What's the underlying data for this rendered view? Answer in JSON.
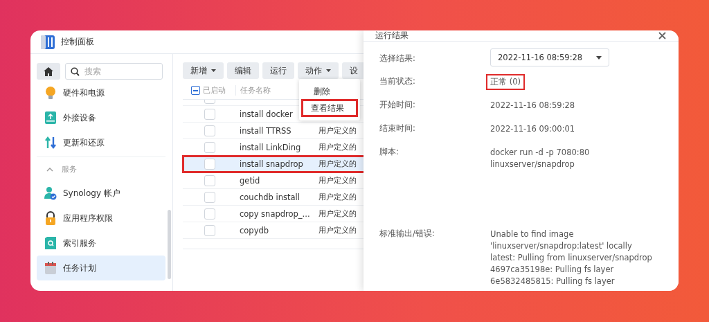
{
  "window": {
    "title": "控制面板"
  },
  "search": {
    "placeholder": "搜索"
  },
  "sidebar": {
    "items": [
      {
        "kind": "item",
        "label": "硬件和电源",
        "selected": false
      },
      {
        "kind": "item",
        "label": "外接设备",
        "selected": false
      },
      {
        "kind": "item",
        "label": "更新和还原",
        "selected": false
      },
      {
        "kind": "section",
        "label": "服务",
        "expanded": true
      },
      {
        "kind": "item",
        "label": "Synology 帐户",
        "selected": false
      },
      {
        "kind": "item",
        "label": "应用程序权限",
        "selected": false
      },
      {
        "kind": "item",
        "label": "索引服务",
        "selected": false
      },
      {
        "kind": "item",
        "label": "任务计划",
        "selected": true
      }
    ]
  },
  "toolbar": [
    {
      "label": "新增",
      "dropdown": true
    },
    {
      "label": "编辑",
      "dropdown": false
    },
    {
      "label": "运行",
      "dropdown": false
    },
    {
      "label": "动作",
      "dropdown": true
    },
    {
      "label": "设",
      "dropdown": false
    }
  ],
  "table": {
    "columns": [
      "已启动",
      "任务名称"
    ],
    "select_all_partial": true,
    "rows": [
      {
        "name": "install docker",
        "checked": false,
        "highlighted": false
      },
      {
        "name": "install TTRSS",
        "type": "用户定义的",
        "checked": false,
        "highlighted": false
      },
      {
        "name": "install LinkDing",
        "type": "用户定义的",
        "checked": false,
        "highlighted": false
      },
      {
        "name": "install snapdrop",
        "type": "用户定义的",
        "checked": false,
        "highlighted": true
      },
      {
        "name": "getid",
        "type": "用户定义的",
        "checked": false,
        "highlighted": false
      },
      {
        "name": "couchdb install",
        "type": "用户定义的",
        "checked": false,
        "highlighted": false
      },
      {
        "name": "copy snapdrop_...",
        "type": "用户定义的",
        "checked": false,
        "highlighted": false
      },
      {
        "name": "copydb",
        "type": "用户定义的",
        "checked": false,
        "highlighted": false
      }
    ]
  },
  "action_menu": [
    {
      "label": "删除",
      "highlighted": false
    },
    {
      "label": "查看结果",
      "highlighted": true
    }
  ],
  "dialog": {
    "title": "运行结果",
    "fields": [
      {
        "kind": "select",
        "label": "选择结果:",
        "value": "2022-11-16 08:59:28",
        "highlighted": false
      },
      {
        "kind": "text",
        "label": "当前状态:",
        "lines": [
          "正常 (0)"
        ],
        "highlighted": true
      },
      {
        "kind": "text",
        "label": "开始时间:",
        "lines": [
          "2022-11-16 08:59:28"
        ],
        "highlighted": false
      },
      {
        "kind": "text",
        "label": "结束时间:",
        "lines": [
          "2022-11-16 09:00:01"
        ],
        "highlighted": false
      },
      {
        "kind": "script",
        "label": "脚本:",
        "lines": [
          "docker run -d -p 7080:80",
          "linuxserver/snapdrop"
        ],
        "highlighted": false
      },
      {
        "kind": "text",
        "label": "标准输出/错误:",
        "lines": [
          "Unable to find image",
          "'linuxserver/snapdrop:latest' locally",
          "latest: Pulling from linuxserver/snapdrop",
          "4697ca35198e: Pulling fs layer",
          "6e5832485815: Pulling fs layer"
        ],
        "highlighted": false
      }
    ]
  }
}
